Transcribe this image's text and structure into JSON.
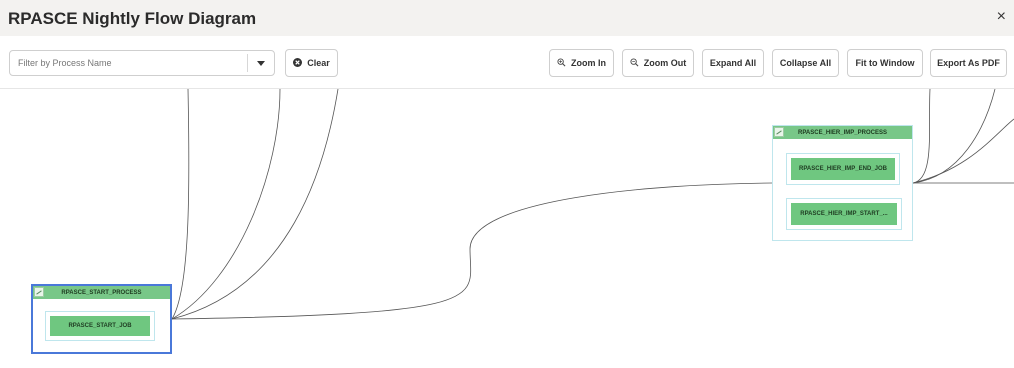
{
  "window": {
    "title": "RPASCE Nightly Flow Diagram",
    "close_glyph": "×"
  },
  "toolbar": {
    "filter_placeholder": "Filter by Process Name",
    "filter_value": "",
    "clear_label": "Clear",
    "zoom_in_label": "Zoom In",
    "zoom_out_label": "Zoom Out",
    "expand_all_label": "Expand All",
    "collapse_all_label": "Collapse All",
    "fit_to_window_label": "Fit to Window",
    "export_pdf_label": "Export As PDF"
  },
  "icons": {
    "filter_dropdown": "chevron-down-icon",
    "clear": "close-circle-icon",
    "zoom_in": "zoom-in-icon",
    "zoom_out": "zoom-out-icon",
    "node_toggle": "collapse-toggle-icon"
  },
  "colors": {
    "process_header": "#78c788",
    "job_fill": "#6fc780",
    "selected_border": "#4a78d9",
    "process_border": "#bfe6ed",
    "edge": "#555555"
  },
  "diagram": {
    "processes": [
      {
        "name": "RPASCE_START_PROCESS",
        "selected": true,
        "jobs": [
          "RPASCE_START_JOB"
        ]
      },
      {
        "name": "RPASCE_HIER_IMP_PROCESS",
        "selected": false,
        "jobs": [
          "RPASCE_HIER_IMP_END_JOB",
          "RPASCE_HIER_IMP_START_..."
        ]
      }
    ]
  }
}
